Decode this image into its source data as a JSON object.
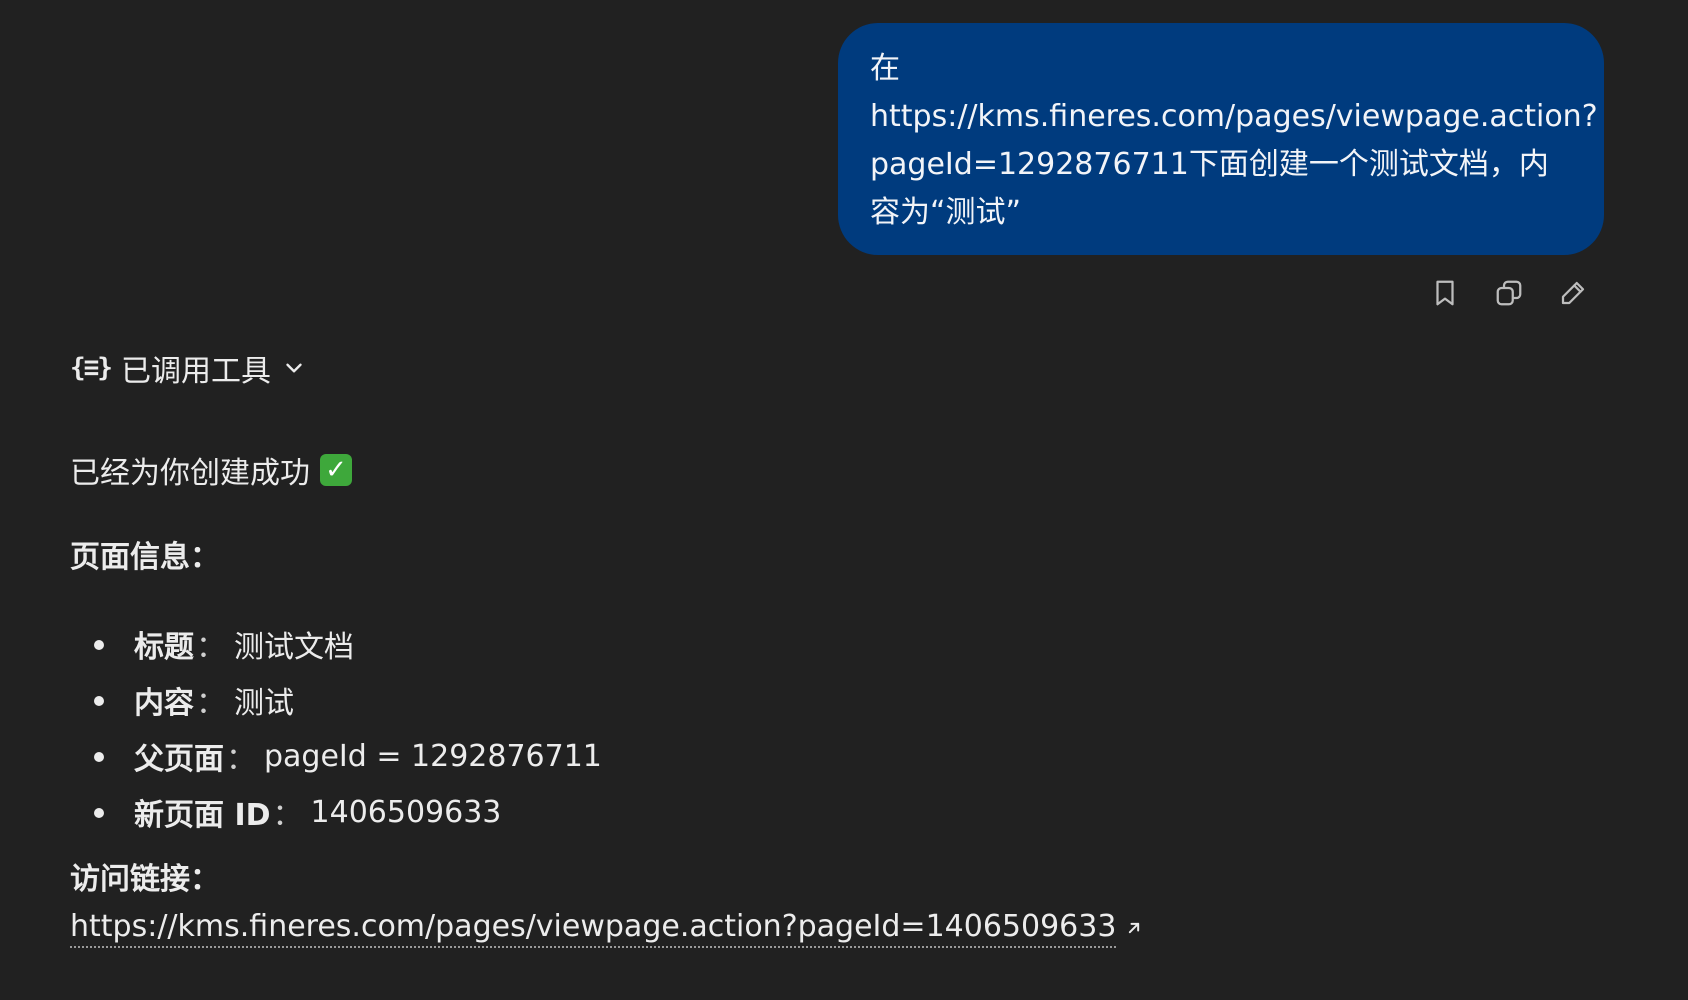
{
  "user_message": {
    "lines": [
      "在",
      "https://kms.fineres.com/pages/viewpage.action?",
      "pageId=1292876711下面创建一个测试文档，内",
      "容为“测试”"
    ]
  },
  "message_actions": {
    "bookmark_icon": "bookmark-icon",
    "copy_icon": "copy-icon",
    "edit_icon": "pencil-icon"
  },
  "tools": {
    "icon": "{≡}",
    "label": "已调用工具"
  },
  "answer": {
    "success_text": "已经为你创建成功",
    "success_emoji": "✓",
    "info_title": "页面信息：",
    "items": [
      {
        "key": "标题",
        "sep": "：",
        "value": "测试文档"
      },
      {
        "key": "内容",
        "sep": "：",
        "value": "测试"
      },
      {
        "key": "父页面",
        "sep": "：",
        "value": "pageId = 1292876711"
      },
      {
        "key": "新页面 ID",
        "sep": "：",
        "value": "1406509633"
      }
    ],
    "link_title": "访问链接：",
    "link": "https://kms.fineres.com/pages/viewpage.action?pageId=1406509633"
  },
  "colors": {
    "background": "#212121",
    "user_bubble": "#003b7e",
    "check": "#3ea83b"
  }
}
